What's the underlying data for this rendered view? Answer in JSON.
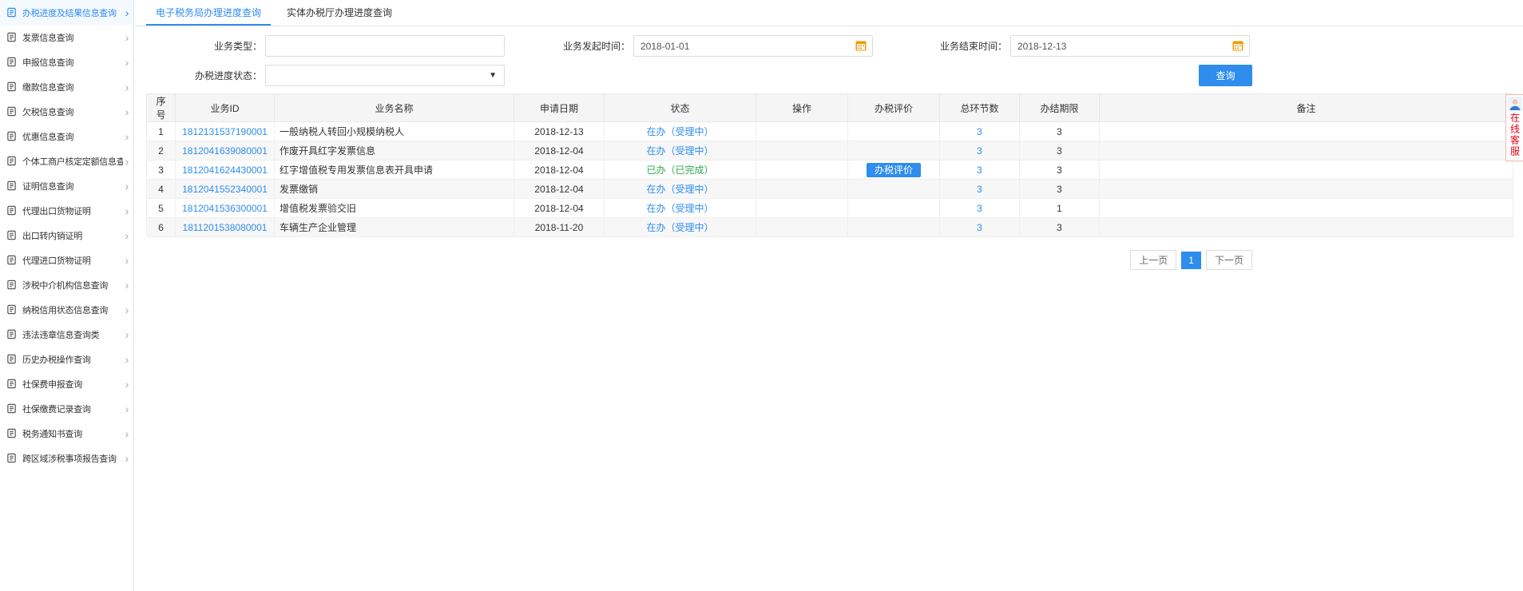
{
  "page": {
    "title": "办税进度及结果信息查询"
  },
  "colors": {
    "accent": "#2e8ded",
    "success_status": "#2fa84f",
    "calendar_icon": "#f39800",
    "service_text": "#e60012"
  },
  "icons": {
    "chevron_right": "›",
    "dropdown_arrow": "▼"
  },
  "sidebar": {
    "items": [
      {
        "label": "办税进度及结果信息查询",
        "icon": "progress-result-query-icon",
        "active": true
      },
      {
        "label": "发票信息查询",
        "icon": "invoice-info-icon",
        "active": false
      },
      {
        "label": "申报信息查询",
        "icon": "declaration-info-icon",
        "active": false
      },
      {
        "label": "缴款信息查询",
        "icon": "payment-info-icon",
        "active": false
      },
      {
        "label": "欠税信息查询",
        "icon": "tax-arrears-icon",
        "active": false
      },
      {
        "label": "优惠信息查询",
        "icon": "preference-info-icon",
        "active": false
      },
      {
        "label": "个体工商户核定定额信息查询",
        "icon": "individual-quota-icon",
        "active": false
      },
      {
        "label": "证明信息查询",
        "icon": "certificate-info-icon",
        "active": false
      },
      {
        "label": "代理出口货物证明",
        "icon": "export-agent-cert-icon",
        "active": false
      },
      {
        "label": "出口转内销证明",
        "icon": "export-to-domestic-cert-icon",
        "active": false
      },
      {
        "label": "代理进口货物证明",
        "icon": "import-agent-cert-icon",
        "active": false
      },
      {
        "label": "涉税中介机构信息查询",
        "icon": "tax-intermediary-icon",
        "active": false
      },
      {
        "label": "纳税信用状态信息查询",
        "icon": "tax-credit-status-icon",
        "active": false
      },
      {
        "label": "违法违章信息查询类",
        "icon": "violation-info-icon",
        "active": false
      },
      {
        "label": "历史办税操作查询",
        "icon": "history-operation-icon",
        "active": false
      },
      {
        "label": "社保费申报查询",
        "icon": "social-security-declare-icon",
        "active": false
      },
      {
        "label": "社保缴费记录查询",
        "icon": "social-security-record-icon",
        "active": false
      },
      {
        "label": "税务通知书查询",
        "icon": "tax-notice-icon",
        "active": false
      },
      {
        "label": "跨区域涉税事项报告查询",
        "icon": "cross-region-report-icon",
        "active": false
      }
    ]
  },
  "tabs": [
    {
      "label": "电子税务局办理进度查询",
      "active": true
    },
    {
      "label": "实体办税厅办理进度查询",
      "active": false
    }
  ],
  "filters": {
    "business_type_label": "业务类型：",
    "business_type_value": "",
    "start_time_label": "业务发起时间：",
    "start_time_value": "2018-01-01",
    "end_time_label": "业务结束时间：",
    "end_time_value": "2018-12-13",
    "progress_status_label": "办税进度状态：",
    "progress_status_value": "",
    "search_button": "查询"
  },
  "table": {
    "headers": [
      "序号",
      "业务ID",
      "业务名称",
      "申请日期",
      "状态",
      "操作",
      "办税评价",
      "总环节数",
      "办结期限",
      "备注"
    ],
    "rows": [
      {
        "seq": "1",
        "id": "1812131537190001",
        "name": "一般纳税人转回小规模纳税人",
        "date": "2018-12-13",
        "status": "在办（受理中）",
        "status_type": "processing",
        "op": "",
        "eval": "",
        "total": "3",
        "deadline": "3",
        "remark": ""
      },
      {
        "seq": "2",
        "id": "1812041639080001",
        "name": "作废开具红字发票信息",
        "date": "2018-12-04",
        "status": "在办（受理中）",
        "status_type": "processing",
        "op": "",
        "eval": "",
        "total": "3",
        "deadline": "3",
        "remark": ""
      },
      {
        "seq": "3",
        "id": "1812041624430001",
        "name": "红字增值税专用发票信息表开具申请",
        "date": "2018-12-04",
        "status": "已办（已完成）",
        "status_type": "done",
        "op": "",
        "eval": "办税评价",
        "total": "3",
        "deadline": "3",
        "remark": ""
      },
      {
        "seq": "4",
        "id": "1812041552340001",
        "name": "发票缴销",
        "date": "2018-12-04",
        "status": "在办（受理中）",
        "status_type": "processing",
        "op": "",
        "eval": "",
        "total": "3",
        "deadline": "3",
        "remark": ""
      },
      {
        "seq": "5",
        "id": "1812041536300001",
        "name": "增值税发票验交旧",
        "date": "2018-12-04",
        "status": "在办（受理中）",
        "status_type": "processing",
        "op": "",
        "eval": "",
        "total": "3",
        "deadline": "1",
        "remark": ""
      },
      {
        "seq": "6",
        "id": "1811201538080001",
        "name": "车辆生产企业管理",
        "date": "2018-11-20",
        "status": "在办（受理中）",
        "status_type": "processing",
        "op": "",
        "eval": "",
        "total": "3",
        "deadline": "3",
        "remark": ""
      }
    ]
  },
  "pagination": {
    "prev": "上一页",
    "current": "1",
    "next": "下一页"
  },
  "floating_service": {
    "label": "在线客服"
  }
}
